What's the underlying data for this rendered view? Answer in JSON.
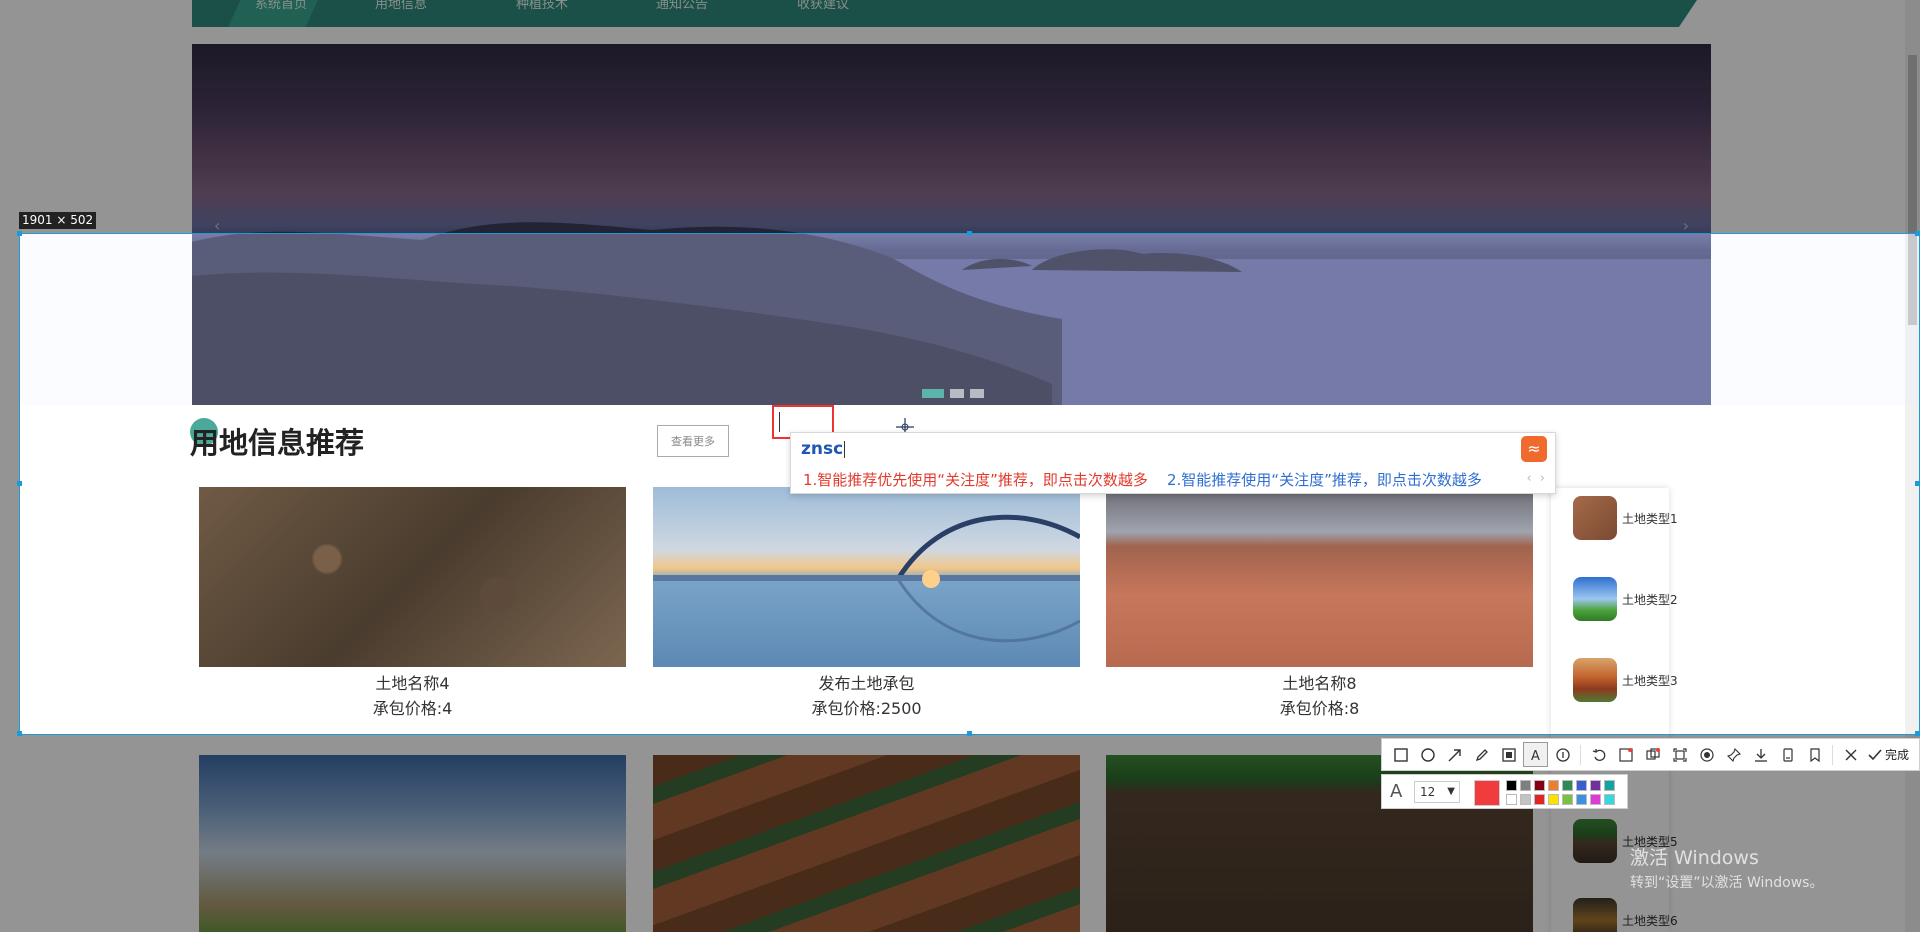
{
  "nav": {
    "items": [
      {
        "label": "系统首页",
        "active": true
      },
      {
        "label": "用地信息"
      },
      {
        "label": "种植技术"
      },
      {
        "label": "通知公告"
      },
      {
        "label": "收获建议"
      }
    ]
  },
  "banner": {
    "prev_icon": "chevron-left-icon",
    "next_icon": "chevron-right-icon",
    "slide_count": 3,
    "active_slide": 1
  },
  "section": {
    "title": "用地信息推荐",
    "more_button": "查看更多"
  },
  "cards": [
    {
      "name": "土地名称4",
      "price": "承包价格:4"
    },
    {
      "name": "发布土地承包",
      "price": "承包价格:2500"
    },
    {
      "name": "土地名称8",
      "price": "承包价格:8"
    }
  ],
  "sidebar": {
    "items": [
      {
        "label": "土地类型1"
      },
      {
        "label": "土地类型2"
      },
      {
        "label": "土地类型3"
      },
      {
        "label": "土地类型5"
      },
      {
        "label": "土地类型6"
      }
    ]
  },
  "screenshot_tool": {
    "size_label": "1901 × 502",
    "toolbar_icons": [
      "rectangle-icon",
      "ellipse-icon",
      "arrow-icon",
      "pencil-icon",
      "mosaic-icon",
      "text-icon",
      "number-icon",
      "undo-icon",
      "ocr-icon",
      "translate-icon",
      "long-capture-icon",
      "record-icon",
      "pin-icon",
      "download-icon",
      "save-icon",
      "bookmark-icon",
      "close-icon",
      "check-icon"
    ],
    "done_label": "完成",
    "font_size": "12",
    "current_color": "#f03c3c",
    "swatches": [
      "#000000",
      "#7f7f7f",
      "#880015",
      "#ed7d31",
      "#2e8b57",
      "#3a5ecf",
      "#7030a0",
      "#13a3a3",
      "#ffffff",
      "#c3c3c3",
      "#e02525",
      "#ffe100",
      "#7ac143",
      "#3f8fe0",
      "#e03ad6",
      "#34d9e0"
    ]
  },
  "ime": {
    "input": "znsc",
    "candidates": [
      "1.智能推荐优先使用“关注度”推荐，即点击次数越多",
      "2.智能推荐使用“关注度”推荐，即点击次数越多"
    ],
    "nav": "‹ ›"
  },
  "os": {
    "activate_title": "激活 Windows",
    "activate_sub": "转到“设置”以激活 Windows。"
  },
  "colors": {
    "nav_bg": "#2e8a7a",
    "accent": "#3fa898",
    "selection": "#1e9bd7",
    "ime_first": "#e23b2e",
    "ime_second": "#2f6fd1"
  }
}
